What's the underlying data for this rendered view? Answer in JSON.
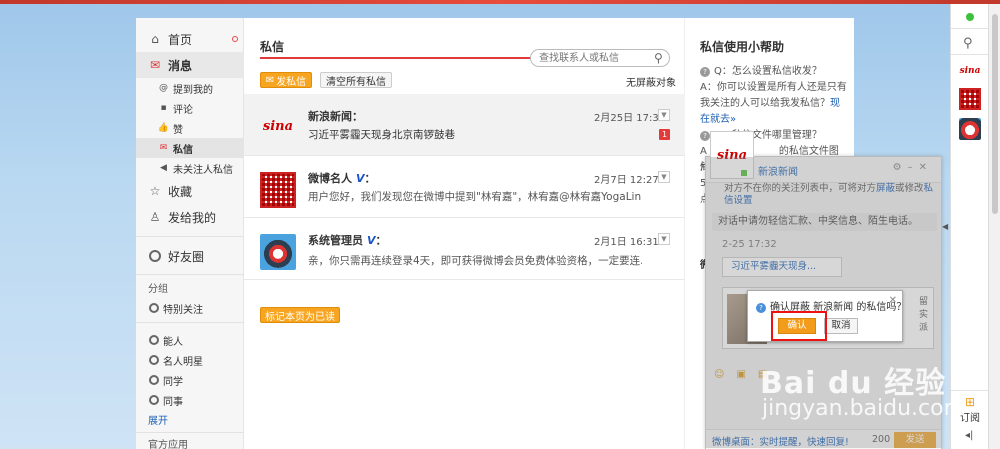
{
  "nav": {
    "home": "首页",
    "messages": "消息",
    "mentions": "提到我的",
    "comments": "评论",
    "likes": "赞",
    "private": "私信",
    "unfollowed": "未关注人私信",
    "favorites": "收藏",
    "sent_to_me": "发给我的",
    "friends_circle": "好友圈",
    "groups_label": "分组",
    "special": "特别关注",
    "group_1": "能人",
    "group_2": "名人明星",
    "group_3": "同学",
    "group_4": "同事",
    "expand": "展开",
    "official_apps": "官方应用"
  },
  "main": {
    "title": "私信",
    "search_placeholder": "查找联系人或私信",
    "compose_btn": "发私信",
    "clear_btn": "清空所有私信",
    "no_shield": "无屏蔽对象",
    "mark_read_btn": "标记本页为已读",
    "messages": [
      {
        "sender": "新浪新闻：",
        "time": "2月25日 17:32",
        "preview": "习近平雾霾天现身北京南锣鼓巷",
        "unread": "1"
      },
      {
        "sender": "微博名人",
        "verified": "V",
        "colon": "：",
        "time": "2月7日 12:27",
        "preview": "用户您好，我们发现您在微博中提到\"林宥嘉\"，林宥嘉@林宥嘉YogaLin ..."
      },
      {
        "sender": "系统管理员",
        "verified": "V",
        "colon": "：",
        "time": "2月1日 16:31",
        "preview": "亲，你只需再连续登录4天，即可获得微博会员免费体验资格，一定要连..."
      }
    ]
  },
  "help": {
    "title": "私信使用小帮助",
    "q1": "Q：怎么设置私信收发？",
    "a1_pre": "A：你可以设置是所有人还是只有我关注的人可以给我发私信？",
    "a1_link": "现在就去»",
    "q2": "Q：私信文件哪里管理？",
    "a2_frag1": "A",
    "a2_frag2": "的私信文件图片均存",
    "frag_3": "储",
    "frag_4": "5",
    "frag_5": "点",
    "frag_6": "微"
  },
  "chat": {
    "name": "新浪新闻",
    "notice_pre": "对方不在你的关注列表中，可将对方",
    "notice_link1": "屏蔽",
    "notice_mid": "或修改",
    "notice_link2": "私信设置",
    "warning": "对话中请勿轻信汇款、中奖信息、陌生电话。",
    "time": "2-25 17:32",
    "bubble": "习近平雾霾天现身...",
    "side_text": "留实派",
    "footer_tip": "微博桌面：实时提醒，快速回复!",
    "count": "200",
    "send": "发送"
  },
  "dialog": {
    "question": "确认屏蔽 新浪新闻 的私信吗？",
    "ok": "确认",
    "cancel": "取消"
  },
  "rbar": {
    "subscribe": "订阅"
  },
  "watermark": {
    "line1": "Bai du 经验",
    "line2": "jingyan.baidu.com"
  }
}
